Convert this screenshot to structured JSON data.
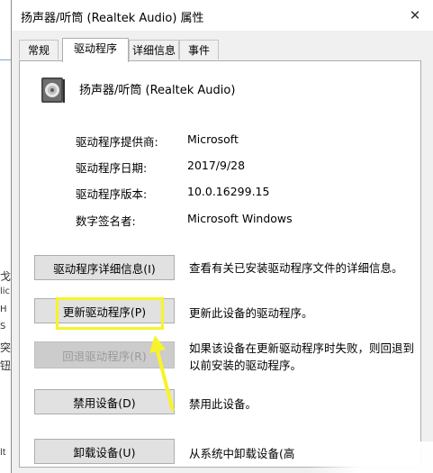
{
  "window": {
    "title": "扬声器/听筒 (Realtek Audio) 属性",
    "close_symbol": "✕"
  },
  "tabs": [
    {
      "label": "常规",
      "active": false
    },
    {
      "label": "驱动程序",
      "active": true
    },
    {
      "label": "详细信息",
      "active": false
    },
    {
      "label": "事件",
      "active": false
    }
  ],
  "device": {
    "name": "扬声器/听筒 (Realtek Audio)",
    "icon": "speaker-icon"
  },
  "info": [
    {
      "label": "驱动程序提供商:",
      "value": "Microsoft"
    },
    {
      "label": "驱动程序日期:",
      "value": "2017/9/28"
    },
    {
      "label": "驱动程序版本:",
      "value": "10.0.16299.15"
    },
    {
      "label": "数字签名者:",
      "value": "Microsoft Windows"
    }
  ],
  "actions": [
    {
      "button": "驱动程序详细信息(I)",
      "description": "查看有关已安装驱动程序文件的详细信息。",
      "enabled": true
    },
    {
      "button": "更新驱动程序(P)",
      "description": "更新此设备的驱动程序。",
      "enabled": true,
      "highlighted": true
    },
    {
      "button": "回退驱动程序(R)",
      "description": "如果该设备在更新驱动程序时失败，则回退到以前安装的驱动程序。",
      "description_lines": [
        "如果该设备在更新驱动程序时失败，则回退到",
        "以前安装的驱动程序。"
      ],
      "enabled": false
    },
    {
      "button": "禁用设备(D)",
      "description": "禁用此设备。",
      "enabled": true
    },
    {
      "button": "卸载设备(U)",
      "description": "从系统中卸载设备(高",
      "enabled": true
    }
  ],
  "background_fragments": [
    "戈",
    "lic",
    "H",
    "S",
    "突",
    "钮",
    "lt"
  ],
  "colors": {
    "highlight": "#f7f32a",
    "dialog_bg": "#f0f0f0",
    "button_bg": "#e1e1e1",
    "disabled_text": "#9a9a9a"
  }
}
